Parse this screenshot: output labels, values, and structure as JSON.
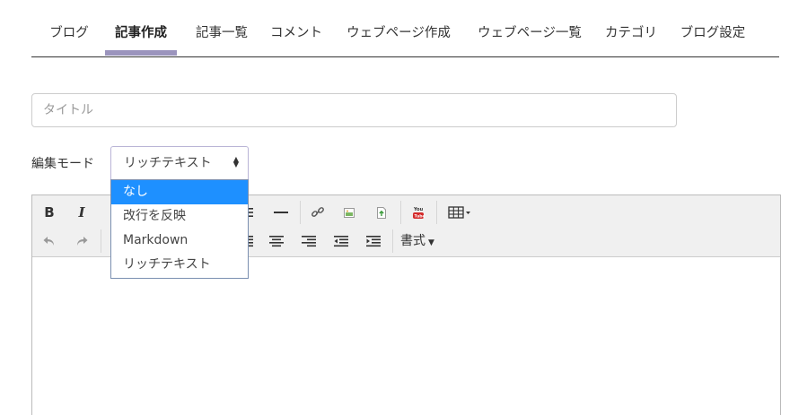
{
  "tabs": [
    {
      "label": "ブログ"
    },
    {
      "label": "記事作成"
    },
    {
      "label": "記事一覧"
    },
    {
      "label": "コメント"
    },
    {
      "label": "ウェブページ作成"
    },
    {
      "label": "ウェブページ一覧"
    },
    {
      "label": "カテゴリ"
    },
    {
      "label": "ブログ設定"
    }
  ],
  "active_tab": "記事作成",
  "title_field": {
    "placeholder": "タイトル",
    "value": ""
  },
  "edit_mode": {
    "label": "編集モード",
    "selected": "リッチテキスト",
    "options": [
      "なし",
      "改行を反映",
      "Markdown",
      "リッチテキスト"
    ],
    "highlighted": "なし"
  },
  "toolbar": {
    "bold": "B",
    "italic": "I",
    "format_label": "書式"
  },
  "colors": {
    "accent": "#9b94bd",
    "highlight": "#1e90ff"
  }
}
